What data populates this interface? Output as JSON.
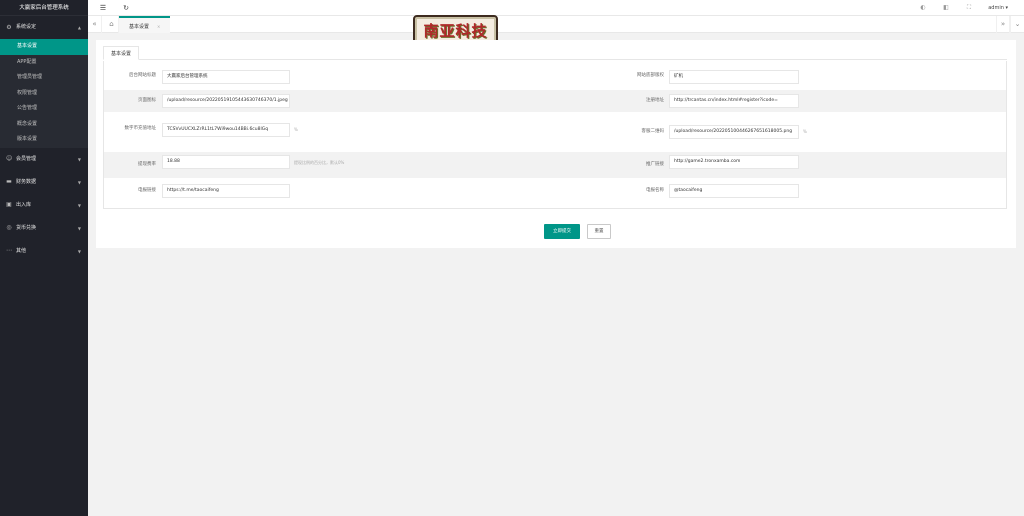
{
  "app": {
    "title": "大赢家后台管理系统"
  },
  "sidebar": {
    "groups": [
      {
        "label": "系统设定",
        "icon": "gear-icon",
        "arrow": "▲",
        "items": [
          "基本设置",
          "APP配置",
          "管理员管理",
          "权限管理",
          "公告管理",
          "概念设置",
          "版本设置"
        ]
      },
      {
        "label": "会员管理",
        "icon": "user-icon",
        "arrow": "▼"
      },
      {
        "label": "财务数据",
        "icon": "money-icon",
        "arrow": "▼"
      },
      {
        "label": "出入库",
        "icon": "box-icon",
        "arrow": "▼"
      },
      {
        "label": "货币兑换",
        "icon": "exchange-icon",
        "arrow": "▼"
      },
      {
        "label": "其他",
        "icon": "more-icon",
        "arrow": "▼"
      }
    ]
  },
  "header": {
    "user": "admin ▾"
  },
  "tabs": [
    {
      "label": "基本设置",
      "close": "×"
    }
  ],
  "badge": {
    "text": "南亚科技"
  },
  "form": {
    "tab": "基本设置",
    "fields": {
      "system_name": {
        "label": "后台网站标题",
        "value": "大赢家后台管理系统"
      },
      "logo": {
        "label": "页面图标",
        "value": "/upload/resource/20220519105443630746370/1.jpeg"
      },
      "key": {
        "label": "数字币充值地址",
        "value": "TCSVvUUCXLZrRL1tL7Wi9wou14BBi.6cu8lGq",
        "hint": "%"
      },
      "price": {
        "label": "提现费率",
        "value": "18.88",
        "hint": "提现比例的百分比，默认0%"
      },
      "tg": {
        "label": "电报链接",
        "value": "https://t.me/taocaifeng"
      },
      "site_name": {
        "label": "网站底部版权",
        "value": "矿机"
      },
      "register": {
        "label": "注册地址",
        "value": "http://trcantas.cn/index.html#register?icode="
      },
      "qrcode": {
        "label": "客服二维码",
        "value": "/upload/resource/202205100446267651618005.png",
        "hint": "%"
      },
      "promo": {
        "label": "推广链接",
        "value": "http://game2.tronxamba.com"
      },
      "tg_name": {
        "label": "电报名称",
        "value": "@taocaifeng"
      }
    }
  },
  "buttons": {
    "submit": "立即提交",
    "reset": "重置"
  }
}
